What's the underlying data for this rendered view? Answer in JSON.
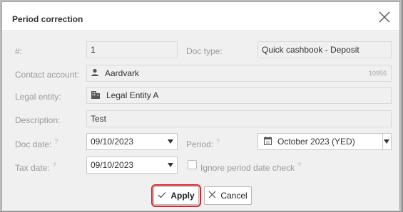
{
  "dialog": {
    "title": "Period correction"
  },
  "form": {
    "number": {
      "label": "#:",
      "value": "1"
    },
    "doc_type": {
      "label": "Doc type:",
      "value": "Quick cashbook - Deposit"
    },
    "contact_account": {
      "label": "Contact account:",
      "value": "Aardvark",
      "code": "10956",
      "icon": "person-icon"
    },
    "legal_entity": {
      "label": "Legal entity:",
      "value": "Legal Entity A",
      "icon": "building-icon"
    },
    "description": {
      "label": "Description:",
      "value": "Test"
    },
    "doc_date": {
      "label": "Doc date:",
      "help": "?",
      "value": "09/10/2023"
    },
    "period": {
      "label": "Period:",
      "help": "?",
      "value": "October 2023 (YED)",
      "icon": "calendar-icon"
    },
    "tax_date": {
      "label": "Tax date:",
      "help": "?",
      "value": "09/10/2023"
    },
    "ignore_period": {
      "label": "Ignore period date check",
      "help": "?",
      "checked": false
    }
  },
  "buttons": {
    "apply": "Apply",
    "cancel": "Cancel"
  },
  "colors": {
    "highlight": "#d9242a",
    "panel": "#f0f0f0"
  }
}
